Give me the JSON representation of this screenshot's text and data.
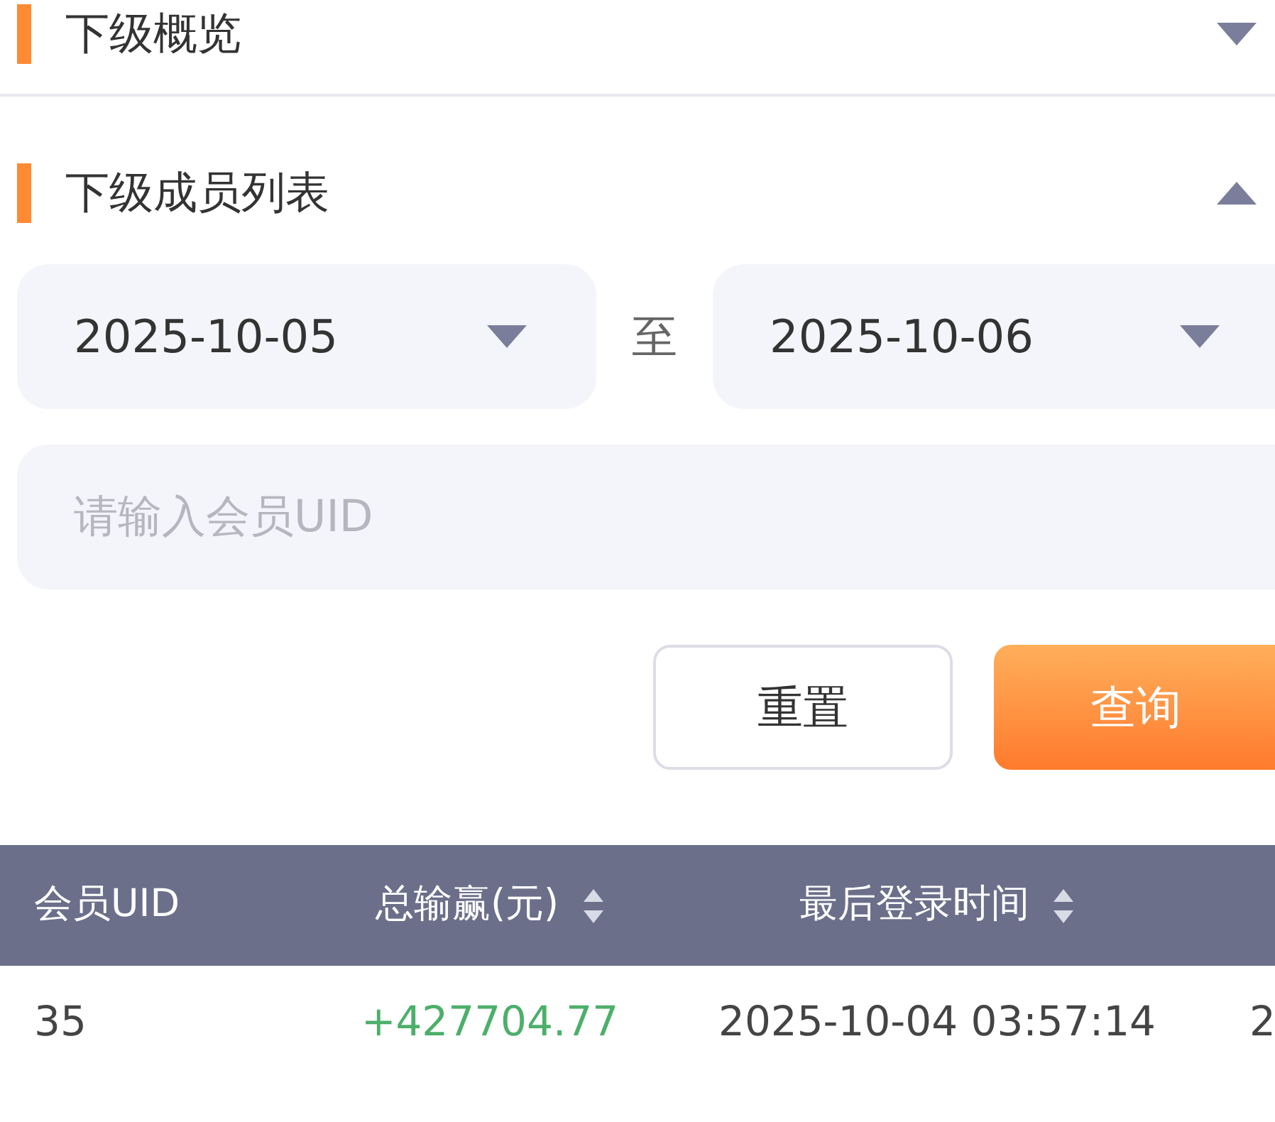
{
  "sections": [
    {
      "title": "下级概览",
      "expanded": false
    },
    {
      "title": "下级成员列表",
      "expanded": true
    }
  ],
  "date_range": {
    "start": "2025-10-05",
    "separator": "至",
    "end": "2025-10-06"
  },
  "uid_field": {
    "placeholder": "请输入会员UID"
  },
  "buttons": [
    {
      "label": "重置",
      "kind": "secondary"
    },
    {
      "label": "查询",
      "kind": "primary"
    }
  ],
  "table": {
    "columns": [
      {
        "label": "会员UID",
        "sortable": false
      },
      {
        "label": "总输赢(元)",
        "sortable": true
      },
      {
        "label": "最后登录时间",
        "sortable": true
      }
    ],
    "rows": [
      {
        "uid": "35",
        "total": "+427704.77",
        "last_login": "2025-10-04 03:57:14",
        "column_4": "2"
      }
    ]
  }
}
